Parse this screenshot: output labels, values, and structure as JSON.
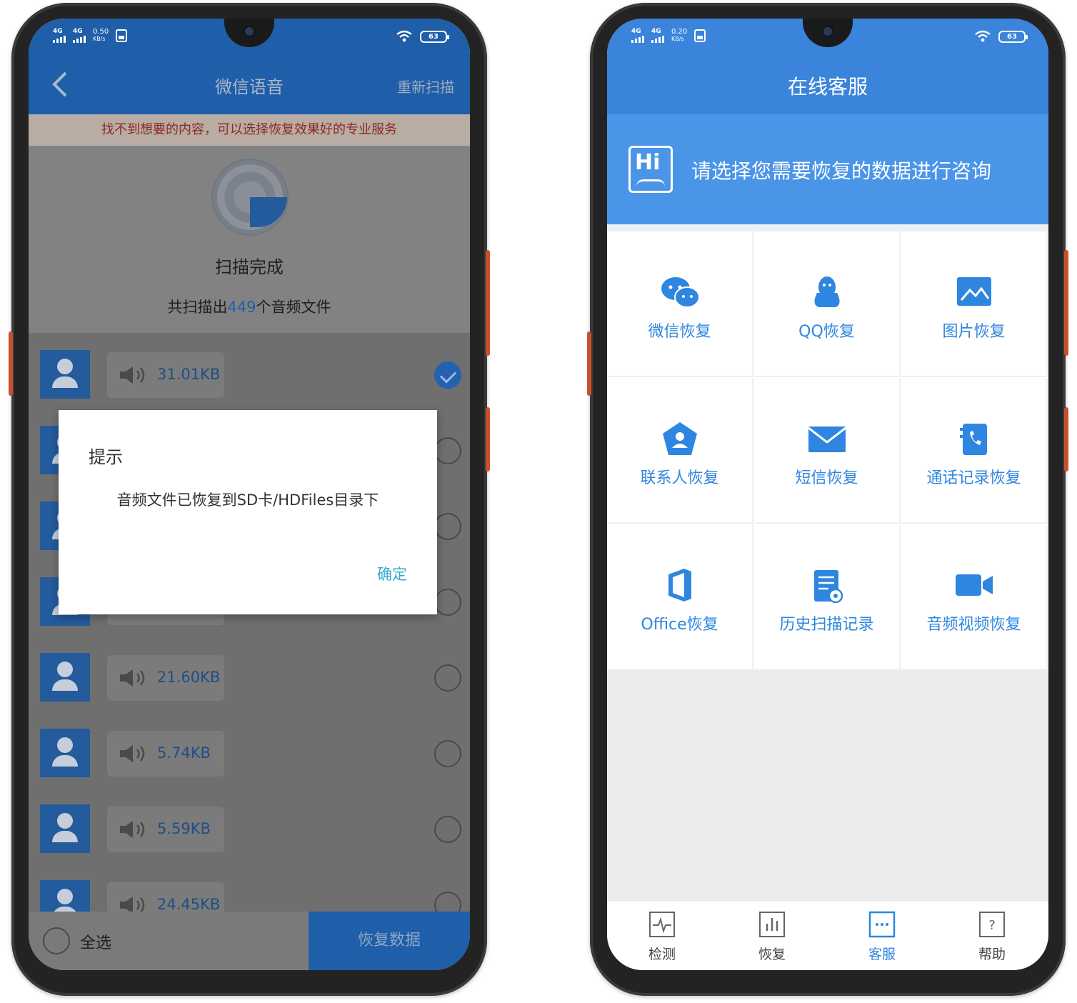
{
  "status": {
    "left_phone": {
      "net1": "4G",
      "net2": "4G",
      "speed": "0.50",
      "speed_unit": "KB/s",
      "battery": "63"
    },
    "right_phone": {
      "net1": "4G",
      "net2": "4G",
      "speed": "0.20",
      "speed_unit": "KB/s",
      "battery": "63"
    }
  },
  "left": {
    "header": {
      "title": "微信语音",
      "rescan": "重新扫描",
      "back_icon": "chevron-left-icon"
    },
    "tip": "找不到想要的内容，可以选择恢复效果好的专业服务",
    "scan": {
      "done": "扫描完成",
      "count_prefix": "共扫描出",
      "count": "449",
      "count_suffix": "个音频文件"
    },
    "files": [
      {
        "size": "31.01KB",
        "checked": true
      },
      {
        "size": "",
        "checked": false
      },
      {
        "size": "",
        "checked": false
      },
      {
        "size": "",
        "checked": false
      },
      {
        "size": "21.60KB",
        "checked": false
      },
      {
        "size": "5.74KB",
        "checked": false
      },
      {
        "size": "5.59KB",
        "checked": false
      },
      {
        "size": "24.45KB",
        "checked": false
      }
    ],
    "bottom": {
      "select_all": "全选",
      "recover": "恢复数据"
    },
    "dialog": {
      "title": "提示",
      "message": "音频文件已恢复到SD卡/HDFiles目录下",
      "ok": "确定"
    }
  },
  "right": {
    "header": {
      "title": "在线客服"
    },
    "banner": {
      "icon": "hi-icon",
      "message": "请选择您需要恢复的数据进行咨询"
    },
    "services": [
      {
        "label": "微信恢复",
        "icon": "wechat-icon"
      },
      {
        "label": "QQ恢复",
        "icon": "qq-icon"
      },
      {
        "label": "图片恢复",
        "icon": "image-icon"
      },
      {
        "label": "联系人恢复",
        "icon": "contacts-icon"
      },
      {
        "label": "短信恢复",
        "icon": "mail-icon"
      },
      {
        "label": "通话记录恢复",
        "icon": "phone-log-icon"
      },
      {
        "label": "Office恢复",
        "icon": "office-icon"
      },
      {
        "label": "历史扫描记录",
        "icon": "history-icon"
      },
      {
        "label": "音频视频恢复",
        "icon": "video-icon"
      }
    ],
    "tabs": [
      {
        "label": "检测",
        "icon": "pulse-icon",
        "active": false
      },
      {
        "label": "恢复",
        "icon": "chart-icon",
        "active": false
      },
      {
        "label": "客服",
        "icon": "chat-icon",
        "active": true
      },
      {
        "label": "帮助",
        "icon": "help-icon",
        "active": false
      }
    ]
  },
  "colors": {
    "primary_dark": "#1f5ea8",
    "primary": "#3a84dc",
    "accent_text": "#2f86e0",
    "dialog_button": "#33aacc",
    "tip_text": "#8c2a22"
  }
}
